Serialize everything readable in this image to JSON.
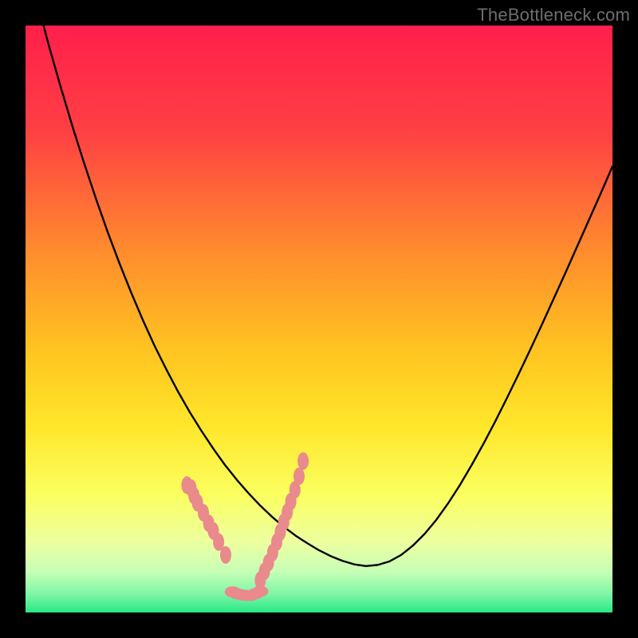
{
  "watermark": "TheBottleneck.com",
  "colors": {
    "black": "#000000",
    "curve": "#000000",
    "marker": "#e98a8d",
    "gradient_stops": [
      {
        "pct": 0,
        "color": "#ff1f4b"
      },
      {
        "pct": 18,
        "color": "#ff4044"
      },
      {
        "pct": 38,
        "color": "#ff8a2e"
      },
      {
        "pct": 55,
        "color": "#ffc321"
      },
      {
        "pct": 68,
        "color": "#ffe62a"
      },
      {
        "pct": 80,
        "color": "#fbff60"
      },
      {
        "pct": 88,
        "color": "#edffa0"
      },
      {
        "pct": 93,
        "color": "#c7ffb6"
      },
      {
        "pct": 97,
        "color": "#7cf5a6"
      },
      {
        "pct": 100,
        "color": "#27e886"
      }
    ]
  },
  "chart_data": {
    "type": "line",
    "title": "",
    "xlabel": "",
    "ylabel": "",
    "xlim": [
      0,
      1
    ],
    "ylim": [
      0,
      1
    ],
    "series": [
      {
        "name": "bottleneck-curve",
        "x": [
          0.0,
          0.02,
          0.04,
          0.06,
          0.08,
          0.1,
          0.12,
          0.14,
          0.16,
          0.18,
          0.2,
          0.22,
          0.24,
          0.26,
          0.28,
          0.3,
          0.32,
          0.34,
          0.36,
          0.38,
          0.4,
          0.42,
          0.44,
          0.46,
          0.48,
          0.5,
          0.52,
          0.54,
          0.56,
          0.58,
          0.6,
          0.62,
          0.64,
          0.66,
          0.68,
          0.7,
          0.72,
          0.74,
          0.76,
          0.78,
          0.8,
          0.82,
          0.84,
          0.86,
          0.88,
          0.9,
          0.92,
          0.94,
          0.96,
          0.98,
          1.0
        ],
        "y": [
          1.12,
          1.04,
          0.965,
          0.895,
          0.828,
          0.765,
          0.705,
          0.648,
          0.595,
          0.545,
          0.498,
          0.454,
          0.414,
          0.376,
          0.341,
          0.309,
          0.279,
          0.251,
          0.226,
          0.203,
          0.182,
          0.163,
          0.146,
          0.131,
          0.118,
          0.106,
          0.096,
          0.088,
          0.082,
          0.079,
          0.081,
          0.087,
          0.098,
          0.114,
          0.134,
          0.158,
          0.186,
          0.217,
          0.251,
          0.287,
          0.325,
          0.365,
          0.406,
          0.448,
          0.491,
          0.535,
          0.579,
          0.624,
          0.669,
          0.714,
          0.76
        ]
      }
    ],
    "markers": {
      "name": "highlight-points",
      "left": [
        [
          0.275,
          0.217
        ],
        [
          0.282,
          0.212
        ],
        [
          0.287,
          0.199
        ],
        [
          0.293,
          0.187
        ],
        [
          0.303,
          0.17
        ],
        [
          0.312,
          0.152
        ],
        [
          0.32,
          0.139
        ],
        [
          0.329,
          0.12
        ],
        [
          0.341,
          0.098
        ]
      ],
      "right": [
        [
          0.4,
          0.055
        ],
        [
          0.407,
          0.07
        ],
        [
          0.414,
          0.085
        ],
        [
          0.421,
          0.102
        ],
        [
          0.428,
          0.12
        ],
        [
          0.434,
          0.137
        ],
        [
          0.44,
          0.154
        ],
        [
          0.446,
          0.171
        ],
        [
          0.452,
          0.189
        ],
        [
          0.459,
          0.209
        ],
        [
          0.466,
          0.232
        ],
        [
          0.473,
          0.258
        ]
      ],
      "floor": [
        [
          0.353,
          0.035
        ],
        [
          0.36,
          0.032
        ],
        [
          0.368,
          0.03
        ],
        [
          0.376,
          0.029
        ],
        [
          0.384,
          0.029
        ],
        [
          0.392,
          0.032
        ],
        [
          0.4,
          0.036
        ]
      ]
    }
  }
}
